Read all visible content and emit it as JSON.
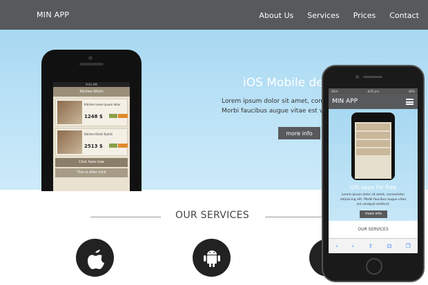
{
  "nav": {
    "brand": "MIN APP",
    "links": [
      "About Us",
      "Services",
      "Prices",
      "Contact"
    ]
  },
  "hero": {
    "title": "iOS Mobile de",
    "text_line1": "Lorem ipsum dolor sit amet, consect",
    "text_line2": "Morbi faucibus augue vitae est vo",
    "button": "more info"
  },
  "services": {
    "title": "OUR SERVICES",
    "icons": [
      "apple-icon",
      "android-icon",
      "windows-icon"
    ]
  },
  "phone_left": {
    "status_time": "9:41 AM",
    "bar_title": "Kitchen Kitchi",
    "items": [
      {
        "title": "Kitchen lorem ipsum dolor",
        "price": "1248 $"
      },
      {
        "title": "Kitchen Kitchi Kutchi",
        "price": "2513 $"
      }
    ],
    "button": "Click here now",
    "button2": "This is after click"
  },
  "phone_right": {
    "status_left": "IDEA",
    "status_time": "8:05 pm",
    "status_right": "80%",
    "header": "MIN APP",
    "hero_title": "iOS apps for free",
    "hero_text1": "Lorem ipsum dolor sit amet, consectetur",
    "hero_text2": "adipiscing elit. Morbi faucibus augue vitae",
    "hero_text3": "est volutpat eleifend.",
    "button": "more info",
    "services": "OUR SERVICES",
    "toolbar": [
      "‹",
      "›",
      "⇧",
      "⊡",
      "❐"
    ]
  }
}
